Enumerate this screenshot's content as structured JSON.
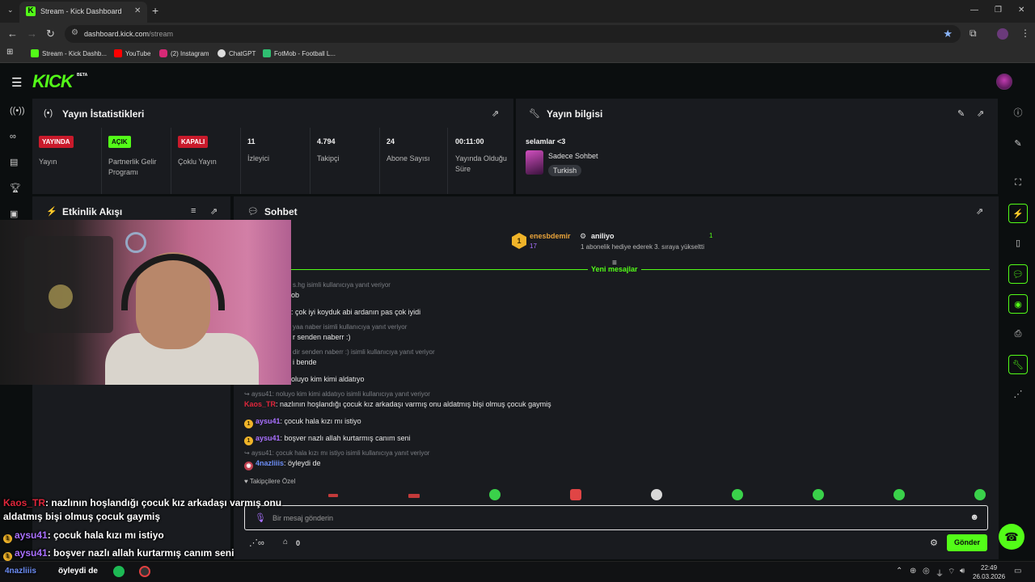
{
  "browser": {
    "tab_title": "Stream - Kick Dashboard",
    "url_host": "dashboard.kick.com",
    "url_path": "/stream",
    "bookmarks": [
      "Stream - Kick Dashb...",
      "YouTube",
      "(2) Instagram",
      "ChatGPT",
      "FotMob - Football L..."
    ]
  },
  "app": {
    "logo": "KICK",
    "beta": "BETA"
  },
  "stats_panel": {
    "title": "Yayın İstatistikleri",
    "items": [
      {
        "badge": "YAYINDA",
        "label": "Yayın"
      },
      {
        "badge": "AÇIK",
        "label": "Partnerlik Gelir Programı"
      },
      {
        "badge": "KAPALI",
        "label": "Çoklu Yayın"
      },
      {
        "value": "11",
        "label": "İzleyici"
      },
      {
        "value": "4.794",
        "label": "Takipçi"
      },
      {
        "value": "24",
        "label": "Abone Sayısı"
      },
      {
        "value": "00:11:00",
        "label": "Yayında Olduğu Süre"
      }
    ]
  },
  "info_panel": {
    "title": "Yayın bilgisi",
    "stream_title": "selamlar <3",
    "category": "Sadece Sohbet",
    "tag": "Turkish"
  },
  "activity_panel": {
    "title": "Etkinlik Akışı"
  },
  "chat_panel": {
    "title": "Sohbet",
    "pinned": {
      "gifter": "enesbdemir",
      "gifter_count": "17",
      "recipient": "aniliyo",
      "count": "1",
      "message": "1 abonelik hediye ederek 3. sıraya yükseltti"
    },
    "divider": "Yeni mesajlar",
    "messages": [
      {
        "reply": "s.hg isimli kullanıcıya yanıt veriyor",
        "text": "ob"
      },
      {
        "text": ": çok iyi koyduk abi ardanın pas çok iyidi"
      },
      {
        "reply": "yaa naber isimli kullanıcıya yanıt veriyor",
        "text": "r senden naberr :)"
      },
      {
        "reply": "dir senden naberr :) isimli kullanıcıya yanıt veriyor",
        "text": "i bende"
      },
      {
        "text": "oluyo kim kimi aldatıyo"
      },
      {
        "reply": "aysu41: noluyo kim kimi aldatıyo isimli kullanıcıya yanıt veriyor",
        "user": "Kaos_TR",
        "text": "nazlının hoşlandığı çocuk kız arkadaşı varmış onu aldatmış bişi olmuş çocuk gaymiş"
      },
      {
        "user": "aysu41",
        "text": "çocuk hala kızı mı istiyo"
      },
      {
        "user": "aysu41",
        "text": "boşver nazlı allah kurtarmış canım seni"
      },
      {
        "reply": "aysu41: çocuk hala kızı mı istiyo isimli kullanıcıya yanıt veriyor",
        "user": "4nazliiis",
        "text": "öyleydi de"
      }
    ],
    "followers_only": "Takipçilere Özel",
    "input_placeholder": "Bir mesaj gönderin",
    "send_label": "Gönder",
    "points": "0"
  },
  "overlay": {
    "lines": [
      {
        "user": "Kaos_TR",
        "text": "nazlının hoşlandığı çocuk kız arkadaşı varmış onu"
      },
      {
        "text": "aldatmış bişi olmuş çocuk gaymiş"
      },
      {
        "user": "aysu41",
        "text": "çocuk hala kızı mı istiyo"
      },
      {
        "user": "aysu41",
        "text": "boşver nazlı allah kurtarmış canım seni"
      },
      {
        "user": "4nazliiis",
        "text": "öyleydi de"
      }
    ]
  },
  "taskbar": {
    "time": "22:49",
    "date": "26.03.2026"
  }
}
